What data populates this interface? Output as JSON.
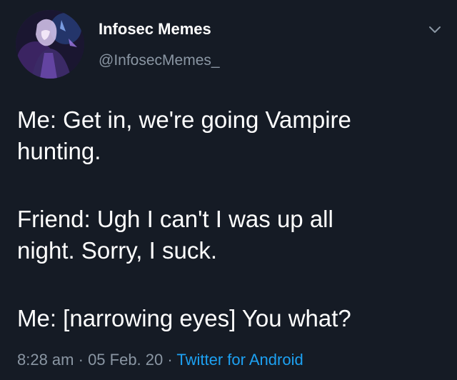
{
  "author": {
    "display_name": "Infosec Memes",
    "handle": "@InfosecMemes_",
    "avatar_icon": "anime-character-avatar"
  },
  "menu_icon": "chevron-down-icon",
  "tweet": {
    "lines": [
      "Me: Get in, we're going Vampire",
      "hunting.",
      "Friend: Ugh I can't I was up all",
      "night. Sorry, I suck.",
      "Me: [narrowing eyes] You what?"
    ]
  },
  "meta": {
    "time": "8:28 am",
    "separator": " · ",
    "date": "05 Feb. 20",
    "source": "Twitter for Android"
  },
  "colors": {
    "background": "#151b25",
    "text": "#ffffff",
    "muted": "#8a96a3",
    "link": "#1da1f2"
  }
}
